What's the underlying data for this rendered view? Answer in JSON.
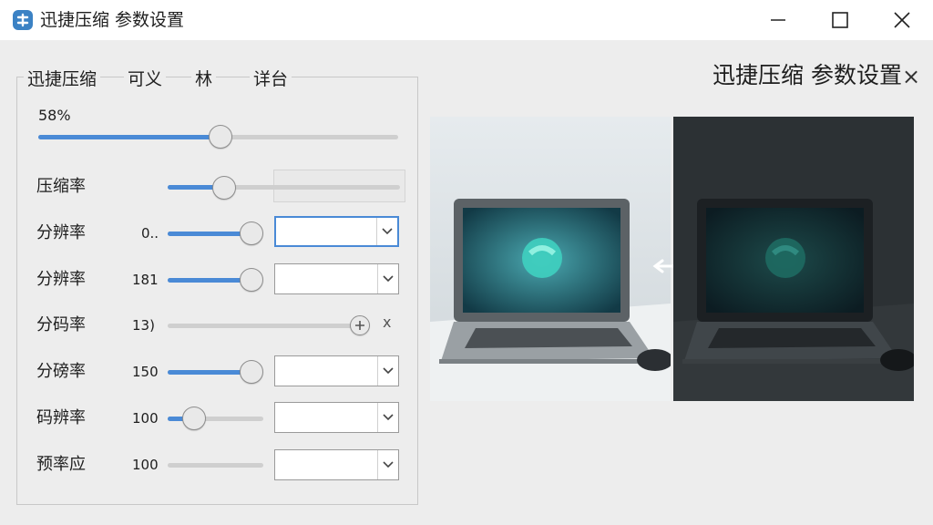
{
  "window": {
    "title": "迅捷压缩 参数设置",
    "icon": "app-logo-icon",
    "controls": [
      "minimize-icon",
      "maximize-icon",
      "close-icon"
    ]
  },
  "tabs": [
    {
      "label": "迅捷压缩"
    },
    {
      "label": "可义"
    },
    {
      "label": "林"
    },
    {
      "label": "详台"
    }
  ],
  "quality": {
    "label": "58%",
    "level_percent": 58
  },
  "rows": [
    {
      "label": "压缩率",
      "value": "",
      "slider_level": 0.15,
      "select_value": ""
    },
    {
      "label": "分辨率",
      "value": "0..",
      "slider_level": 1.0,
      "select_value": ""
    },
    {
      "label": "分辨率",
      "value": "181",
      "slider_level": 1.0,
      "select_value": ""
    },
    {
      "label": "分码率",
      "value": "13)",
      "slider_level": 1.0,
      "select_value": ""
    },
    {
      "label": "分磅率",
      "value": "150",
      "slider_level": 1.0,
      "select_value": ""
    },
    {
      "label": "码辨率",
      "value": "100",
      "slider_level": 0.2,
      "select_value": ""
    },
    {
      "label": "预率应",
      "value": "100",
      "slider_level": 0.0,
      "select_value": ""
    }
  ],
  "extra_mark": "х",
  "preview": {
    "title": "迅捷压缩 参数设置",
    "close_glyph": "×",
    "before_image": "laptop-photo-bright",
    "after_image": "laptop-photo-dark",
    "compare_icon": "arrow-left-icon"
  },
  "colors": {
    "accent": "#4a8ad6",
    "app_icon": "#3b82c4",
    "background": "#ededed"
  }
}
